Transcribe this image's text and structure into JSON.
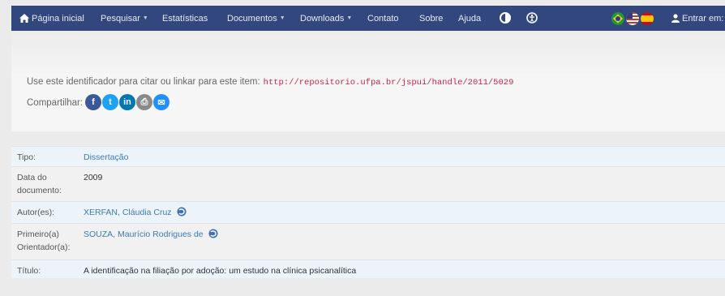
{
  "nav": {
    "home": "Página inicial",
    "search": "Pesquisar",
    "stats": "Estatísticas",
    "documents": "Documentos",
    "downloads": "Downloads",
    "contact": "Contato",
    "about": "Sobre",
    "help": "Ajuda",
    "login": "Entrar em:"
  },
  "colors": {
    "navbar": "#32477d",
    "link": "#3d7bb1",
    "handle": "#c7254e"
  },
  "identifier": {
    "text": "Use este identificador para citar ou linkar para este item:",
    "url": "http://repositorio.ufpa.br/jspui/handle/2011/5029"
  },
  "share": {
    "label": "Compartilhar:",
    "buttons": [
      {
        "icon": "facebook-icon",
        "glyph": "f",
        "color": "#3b5998"
      },
      {
        "icon": "twitter-icon",
        "glyph": "t",
        "color": "#1da1f2"
      },
      {
        "icon": "linkedin-icon",
        "glyph": "in",
        "color": "#0077b5"
      },
      {
        "icon": "print-icon",
        "glyph": "⎙",
        "color": "#8a8a8a"
      },
      {
        "icon": "email-icon",
        "glyph": "✉",
        "color": "#1e90ff"
      }
    ]
  },
  "metadata": [
    {
      "label": "Tipo:",
      "value": "Dissertação",
      "link": true,
      "orcid": false
    },
    {
      "label": "Data do documento:",
      "value": "2009",
      "link": false,
      "orcid": false
    },
    {
      "label": "Autor(es):",
      "value": "XERFAN, Cláudia Cruz",
      "link": true,
      "orcid": true
    },
    {
      "label": "Primeiro(a) Orientador(a):",
      "value": "SOUZA, Maurício Rodrigues de",
      "link": true,
      "orcid": true
    },
    {
      "label": "Título:",
      "value": "A identificação na filiação por adoção: um estudo na clínica psicanalítica",
      "link": false,
      "orcid": false
    }
  ]
}
